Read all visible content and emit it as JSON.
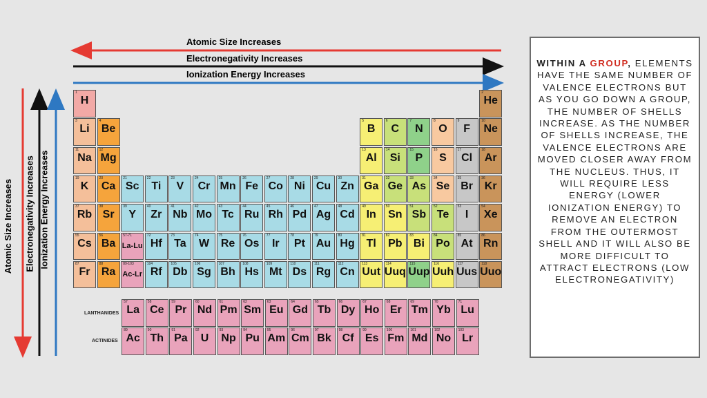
{
  "trends": {
    "horizontal": [
      {
        "label": "Atomic Size Increases",
        "color": "#e53a32",
        "direction": "left"
      },
      {
        "label": "Electronegativity Increases",
        "color": "#111111",
        "direction": "right"
      },
      {
        "label": "Ionization Energy Increases",
        "color": "#2e78c2",
        "direction": "right"
      }
    ],
    "vertical": [
      {
        "label": "Atomic Size Increases",
        "color": "#e53a32",
        "direction": "down"
      },
      {
        "label": "Electronegativity Increases",
        "color": "#111111",
        "direction": "up"
      },
      {
        "label": "Ionization Energy Increases",
        "color": "#2e78c2",
        "direction": "up"
      }
    ]
  },
  "categories": {
    "hydrogen": "#f2a9a6",
    "alkali": "#f4bf9a",
    "alkaline_earth": "#f5a43c",
    "transition": "#a8dbe6",
    "post_transition": "#f6ef74",
    "metalloid": "#c8e07a",
    "nonmetal": "#8fd18a",
    "other_nonmetal": "#f8c9a0",
    "halogen": "#c7c7c7",
    "noble_gas": "#c9945b",
    "lanthanide": "#e9a3bb",
    "actinide": "#e9a3bb"
  },
  "row_labels": {
    "lanthanides": "LANTHANIDES",
    "actinides": "ACTINIDES"
  },
  "elements": [
    {
      "n": "1",
      "s": "H",
      "cat": "hydrogen",
      "g": 1,
      "p": 1
    },
    {
      "n": "2",
      "s": "He",
      "cat": "noble_gas",
      "g": 18,
      "p": 1
    },
    {
      "n": "3",
      "s": "Li",
      "cat": "alkali",
      "g": 1,
      "p": 2
    },
    {
      "n": "4",
      "s": "Be",
      "cat": "alkaline_earth",
      "g": 2,
      "p": 2
    },
    {
      "n": "5",
      "s": "B",
      "cat": "post_transition",
      "g": 13,
      "p": 2
    },
    {
      "n": "6",
      "s": "C",
      "cat": "metalloid",
      "g": 14,
      "p": 2
    },
    {
      "n": "7",
      "s": "N",
      "cat": "nonmetal",
      "g": 15,
      "p": 2
    },
    {
      "n": "8",
      "s": "O",
      "cat": "other_nonmetal",
      "g": 16,
      "p": 2
    },
    {
      "n": "9",
      "s": "F",
      "cat": "halogen",
      "g": 17,
      "p": 2
    },
    {
      "n": "10",
      "s": "Ne",
      "cat": "noble_gas",
      "g": 18,
      "p": 2
    },
    {
      "n": "11",
      "s": "Na",
      "cat": "alkali",
      "g": 1,
      "p": 3
    },
    {
      "n": "12",
      "s": "Mg",
      "cat": "alkaline_earth",
      "g": 2,
      "p": 3
    },
    {
      "n": "13",
      "s": "Al",
      "cat": "post_transition",
      "g": 13,
      "p": 3
    },
    {
      "n": "14",
      "s": "Si",
      "cat": "metalloid",
      "g": 14,
      "p": 3
    },
    {
      "n": "15",
      "s": "P",
      "cat": "nonmetal",
      "g": 15,
      "p": 3
    },
    {
      "n": "16",
      "s": "S",
      "cat": "other_nonmetal",
      "g": 16,
      "p": 3
    },
    {
      "n": "17",
      "s": "Cl",
      "cat": "halogen",
      "g": 17,
      "p": 3
    },
    {
      "n": "18",
      "s": "Ar",
      "cat": "noble_gas",
      "g": 18,
      "p": 3
    },
    {
      "n": "19",
      "s": "K",
      "cat": "alkali",
      "g": 1,
      "p": 4
    },
    {
      "n": "20",
      "s": "Ca",
      "cat": "alkaline_earth",
      "g": 2,
      "p": 4
    },
    {
      "n": "21",
      "s": "Sc",
      "cat": "transition",
      "g": 3,
      "p": 4
    },
    {
      "n": "22",
      "s": "Ti",
      "cat": "transition",
      "g": 4,
      "p": 4
    },
    {
      "n": "23",
      "s": "V",
      "cat": "transition",
      "g": 5,
      "p": 4
    },
    {
      "n": "24",
      "s": "Cr",
      "cat": "transition",
      "g": 6,
      "p": 4
    },
    {
      "n": "25",
      "s": "Mn",
      "cat": "transition",
      "g": 7,
      "p": 4
    },
    {
      "n": "26",
      "s": "Fe",
      "cat": "transition",
      "g": 8,
      "p": 4
    },
    {
      "n": "27",
      "s": "Co",
      "cat": "transition",
      "g": 9,
      "p": 4
    },
    {
      "n": "28",
      "s": "Ni",
      "cat": "transition",
      "g": 10,
      "p": 4
    },
    {
      "n": "29",
      "s": "Cu",
      "cat": "transition",
      "g": 11,
      "p": 4
    },
    {
      "n": "30",
      "s": "Zn",
      "cat": "transition",
      "g": 12,
      "p": 4
    },
    {
      "n": "31",
      "s": "Ga",
      "cat": "post_transition",
      "g": 13,
      "p": 4
    },
    {
      "n": "32",
      "s": "Ge",
      "cat": "metalloid",
      "g": 14,
      "p": 4
    },
    {
      "n": "33",
      "s": "As",
      "cat": "metalloid",
      "g": 15,
      "p": 4
    },
    {
      "n": "34",
      "s": "Se",
      "cat": "other_nonmetal",
      "g": 16,
      "p": 4
    },
    {
      "n": "35",
      "s": "Br",
      "cat": "halogen",
      "g": 17,
      "p": 4
    },
    {
      "n": "36",
      "s": "Kr",
      "cat": "noble_gas",
      "g": 18,
      "p": 4
    },
    {
      "n": "37",
      "s": "Rb",
      "cat": "alkali",
      "g": 1,
      "p": 5
    },
    {
      "n": "38",
      "s": "Sr",
      "cat": "alkaline_earth",
      "g": 2,
      "p": 5
    },
    {
      "n": "39",
      "s": "Y",
      "cat": "transition",
      "g": 3,
      "p": 5
    },
    {
      "n": "40",
      "s": "Zr",
      "cat": "transition",
      "g": 4,
      "p": 5
    },
    {
      "n": "41",
      "s": "Nb",
      "cat": "transition",
      "g": 5,
      "p": 5
    },
    {
      "n": "42",
      "s": "Mo",
      "cat": "transition",
      "g": 6,
      "p": 5
    },
    {
      "n": "43",
      "s": "Tc",
      "cat": "transition",
      "g": 7,
      "p": 5
    },
    {
      "n": "44",
      "s": "Ru",
      "cat": "transition",
      "g": 8,
      "p": 5
    },
    {
      "n": "45",
      "s": "Rh",
      "cat": "transition",
      "g": 9,
      "p": 5
    },
    {
      "n": "46",
      "s": "Pd",
      "cat": "transition",
      "g": 10,
      "p": 5
    },
    {
      "n": "47",
      "s": "Ag",
      "cat": "transition",
      "g": 11,
      "p": 5
    },
    {
      "n": "48",
      "s": "Cd",
      "cat": "transition",
      "g": 12,
      "p": 5
    },
    {
      "n": "49",
      "s": "In",
      "cat": "post_transition",
      "g": 13,
      "p": 5
    },
    {
      "n": "50",
      "s": "Sn",
      "cat": "post_transition",
      "g": 14,
      "p": 5
    },
    {
      "n": "51",
      "s": "Sb",
      "cat": "metalloid",
      "g": 15,
      "p": 5
    },
    {
      "n": "52",
      "s": "Te",
      "cat": "metalloid",
      "g": 16,
      "p": 5
    },
    {
      "n": "53",
      "s": "I",
      "cat": "halogen",
      "g": 17,
      "p": 5
    },
    {
      "n": "54",
      "s": "Xe",
      "cat": "noble_gas",
      "g": 18,
      "p": 5
    },
    {
      "n": "55",
      "s": "Cs",
      "cat": "alkali",
      "g": 1,
      "p": 6
    },
    {
      "n": "56",
      "s": "Ba",
      "cat": "alkaline_earth",
      "g": 2,
      "p": 6
    },
    {
      "n": "57-71",
      "s": "La-Lu",
      "cat": "lanthanide",
      "g": 3,
      "p": 6,
      "small": true
    },
    {
      "n": "72",
      "s": "Hf",
      "cat": "transition",
      "g": 4,
      "p": 6
    },
    {
      "n": "73",
      "s": "Ta",
      "cat": "transition",
      "g": 5,
      "p": 6
    },
    {
      "n": "74",
      "s": "W",
      "cat": "transition",
      "g": 6,
      "p": 6
    },
    {
      "n": "75",
      "s": "Re",
      "cat": "transition",
      "g": 7,
      "p": 6
    },
    {
      "n": "76",
      "s": "Os",
      "cat": "transition",
      "g": 8,
      "p": 6
    },
    {
      "n": "77",
      "s": "Ir",
      "cat": "transition",
      "g": 9,
      "p": 6
    },
    {
      "n": "78",
      "s": "Pt",
      "cat": "transition",
      "g": 10,
      "p": 6
    },
    {
      "n": "79",
      "s": "Au",
      "cat": "transition",
      "g": 11,
      "p": 6
    },
    {
      "n": "80",
      "s": "Hg",
      "cat": "transition",
      "g": 12,
      "p": 6
    },
    {
      "n": "81",
      "s": "Tl",
      "cat": "post_transition",
      "g": 13,
      "p": 6
    },
    {
      "n": "82",
      "s": "Pb",
      "cat": "post_transition",
      "g": 14,
      "p": 6
    },
    {
      "n": "83",
      "s": "Bi",
      "cat": "post_transition",
      "g": 15,
      "p": 6
    },
    {
      "n": "84",
      "s": "Po",
      "cat": "metalloid",
      "g": 16,
      "p": 6
    },
    {
      "n": "85",
      "s": "At",
      "cat": "halogen",
      "g": 17,
      "p": 6
    },
    {
      "n": "86",
      "s": "Rn",
      "cat": "noble_gas",
      "g": 18,
      "p": 6
    },
    {
      "n": "87",
      "s": "Fr",
      "cat": "alkali",
      "g": 1,
      "p": 7
    },
    {
      "n": "88",
      "s": "Ra",
      "cat": "alkaline_earth",
      "g": 2,
      "p": 7
    },
    {
      "n": "89-103",
      "s": "Ac-Lr",
      "cat": "actinide",
      "g": 3,
      "p": 7,
      "small": true
    },
    {
      "n": "104",
      "s": "Rf",
      "cat": "transition",
      "g": 4,
      "p": 7
    },
    {
      "n": "105",
      "s": "Db",
      "cat": "transition",
      "g": 5,
      "p": 7
    },
    {
      "n": "106",
      "s": "Sg",
      "cat": "transition",
      "g": 6,
      "p": 7
    },
    {
      "n": "107",
      "s": "Bh",
      "cat": "transition",
      "g": 7,
      "p": 7
    },
    {
      "n": "108",
      "s": "Hs",
      "cat": "transition",
      "g": 8,
      "p": 7
    },
    {
      "n": "109",
      "s": "Mt",
      "cat": "transition",
      "g": 9,
      "p": 7
    },
    {
      "n": "110",
      "s": "Ds",
      "cat": "transition",
      "g": 10,
      "p": 7
    },
    {
      "n": "111",
      "s": "Rg",
      "cat": "transition",
      "g": 11,
      "p": 7
    },
    {
      "n": "112",
      "s": "Cn",
      "cat": "transition",
      "g": 12,
      "p": 7
    },
    {
      "n": "113",
      "s": "Uut",
      "cat": "post_transition",
      "g": 13,
      "p": 7
    },
    {
      "n": "114",
      "s": "Uuq",
      "cat": "post_transition",
      "g": 14,
      "p": 7
    },
    {
      "n": "115",
      "s": "Uup",
      "cat": "nonmetal",
      "g": 15,
      "p": 7
    },
    {
      "n": "116",
      "s": "Uuh",
      "cat": "post_transition",
      "g": 16,
      "p": 7
    },
    {
      "n": "117",
      "s": "Uus",
      "cat": "halogen",
      "g": 17,
      "p": 7
    },
    {
      "n": "118",
      "s": "Uuo",
      "cat": "noble_gas",
      "g": 18,
      "p": 7
    }
  ],
  "lanthanides": [
    {
      "n": "57",
      "s": "La"
    },
    {
      "n": "58",
      "s": "Ce"
    },
    {
      "n": "59",
      "s": "Pr"
    },
    {
      "n": "60",
      "s": "Nd"
    },
    {
      "n": "61",
      "s": "Pm"
    },
    {
      "n": "62",
      "s": "Sm"
    },
    {
      "n": "63",
      "s": "Eu"
    },
    {
      "n": "64",
      "s": "Gd"
    },
    {
      "n": "65",
      "s": "Tb"
    },
    {
      "n": "66",
      "s": "Dy"
    },
    {
      "n": "67",
      "s": "Ho"
    },
    {
      "n": "68",
      "s": "Er"
    },
    {
      "n": "69",
      "s": "Tm"
    },
    {
      "n": "70",
      "s": "Yb"
    },
    {
      "n": "71",
      "s": "Lu"
    }
  ],
  "actinides": [
    {
      "n": "89",
      "s": "Ac"
    },
    {
      "n": "90",
      "s": "Th"
    },
    {
      "n": "91",
      "s": "Pa"
    },
    {
      "n": "92",
      "s": "U"
    },
    {
      "n": "93",
      "s": "Np"
    },
    {
      "n": "94",
      "s": "Pu"
    },
    {
      "n": "95",
      "s": "Am"
    },
    {
      "n": "96",
      "s": "Cm"
    },
    {
      "n": "97",
      "s": "Bk"
    },
    {
      "n": "98",
      "s": "Cf"
    },
    {
      "n": "99",
      "s": "Es"
    },
    {
      "n": "100",
      "s": "Fm"
    },
    {
      "n": "101",
      "s": "Md"
    },
    {
      "n": "102",
      "s": "No"
    },
    {
      "n": "103",
      "s": "Lr"
    }
  ],
  "textbox": {
    "lead": "Within a ",
    "highlight": "group",
    "after": ", ",
    "body": "elements have the same number of valence electrons but as you go down a group, the number of shells increase. As the number of shells increase, the valence electrons are moved closer away from the nucleus. Thus, it will require less energy (lower ionization energy) to remove an electron from the outermost shell and it will also be more difficult to attract electrons (low electronegativity)"
  }
}
